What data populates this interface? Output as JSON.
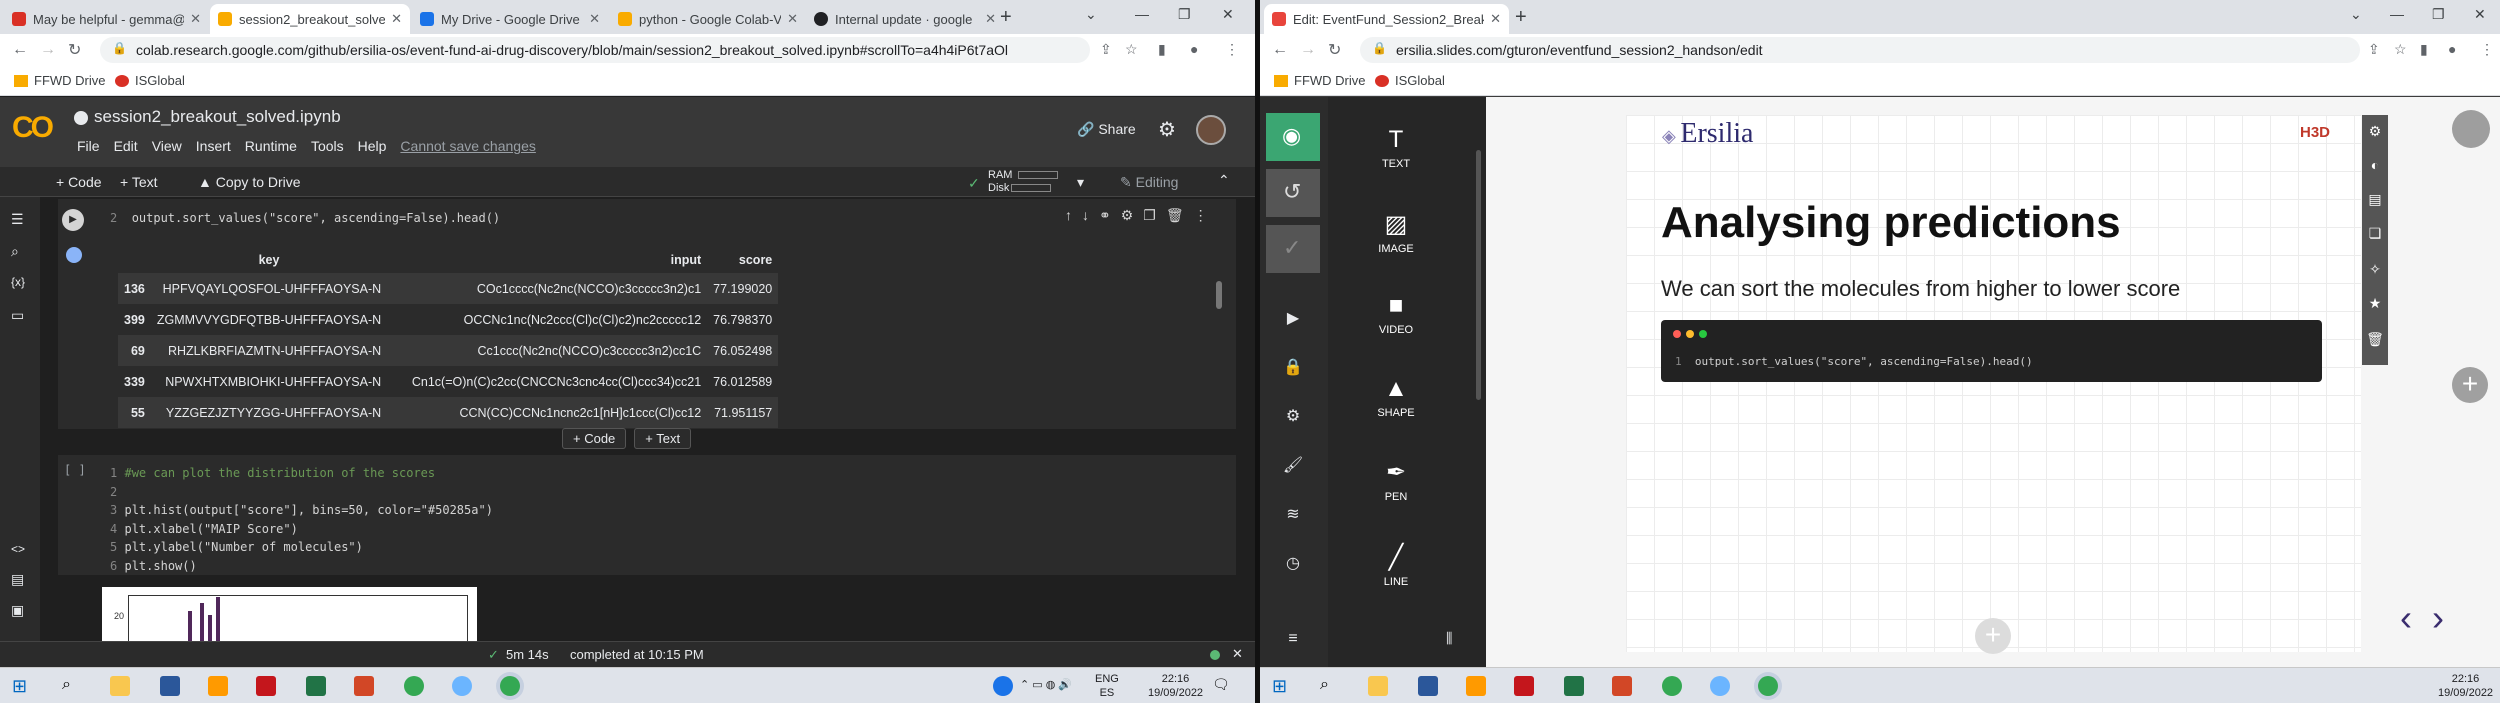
{
  "left_browser": {
    "tabs": [
      {
        "title": "May be helpful - gemma@",
        "color": "#d93025"
      },
      {
        "title": "session2_breakout_solved.",
        "color": "#f9ab00"
      },
      {
        "title": "My Drive - Google Drive",
        "color": "#1a73e8"
      },
      {
        "title": "python - Google Colab-V",
        "color": "#f9ab00"
      },
      {
        "title": "Internal update · google",
        "color": "#202124"
      }
    ],
    "url": "colab.research.google.com/github/ersilia-os/event-fund-ai-drug-discovery/blob/main/session2_breakout_solved.ipynb#scrollTo=a4h4iP6t7aOl",
    "bookmarks": [
      "FFWD Drive",
      "ISGlobal"
    ]
  },
  "colab": {
    "logo": "CO",
    "notebook_title": "session2_breakout_solved.ipynb",
    "menus": [
      "File",
      "Edit",
      "View",
      "Insert",
      "Runtime",
      "Tools",
      "Help"
    ],
    "cant_save": "Cannot save changes",
    "share": "Share",
    "toolbar": {
      "add_code": "+ Code",
      "add_text": "+ Text",
      "copy": "Copy to Drive",
      "ram": "RAM",
      "disk": "Disk",
      "editing": "Editing"
    },
    "cell1_code": {
      "line_no": "2",
      "code": "output.sort_values(\"score\", ascending=False).head()"
    },
    "table": {
      "headers": [
        "",
        "key",
        "input",
        "score"
      ],
      "rows": [
        [
          "136",
          "HPFVQAYLQOSFOL-UHFFFAOYSA-N",
          "COc1cccc(Nc2nc(NCCO)c3ccccc3n2)c1",
          "77.199020"
        ],
        [
          "399",
          "ZGMMVVYGDFQTBB-UHFFFAOYSA-N",
          "OCCNc1nc(Nc2ccc(Cl)c(Cl)c2)nc2ccccc12",
          "76.798370"
        ],
        [
          "69",
          "RHZLKBRFIAZMTN-UHFFFAOYSA-N",
          "Cc1ccc(Nc2nc(NCCO)c3ccccc3n2)cc1C",
          "76.052498"
        ],
        [
          "339",
          "NPWXHTXMBIOHKI-UHFFFAOYSA-N",
          "Cn1c(=O)n(C)c2cc(CNCCNc3cnc4cc(Cl)ccc34)cc21",
          "76.012589"
        ],
        [
          "55",
          "YZZGEZJZTYYZGG-UHFFFAOYSA-N",
          "CCN(CC)CCNc1ncnc2c1[nH]c1ccc(Cl)cc12",
          "71.951157"
        ]
      ]
    },
    "add_code": "+ Code",
    "add_text": "+ Text",
    "cell2": {
      "bracket": "[ ]",
      "lines": [
        {
          "n": "1",
          "text": "#we can plot the distribution of the scores"
        },
        {
          "n": "2",
          "text": ""
        },
        {
          "n": "3",
          "text": "plt.hist(output[\"score\"], bins=50, color=\"#50285a\")"
        },
        {
          "n": "4",
          "text": "plt.xlabel(\"MAIP Score\")"
        },
        {
          "n": "5",
          "text": "plt.ylabel(\"Number of molecules\")"
        },
        {
          "n": "6",
          "text": "plt.show()"
        }
      ]
    },
    "plot_ytick": "20",
    "status": {
      "duration": "5m 14s",
      "completed": "completed at 10:15 PM"
    }
  },
  "left_taskbar": {
    "lang": "ENG",
    "region": "ES",
    "time": "22:16",
    "date": "19/09/2022"
  },
  "right_browser": {
    "tab_title": "Edit: EventFund_Session2_Breako",
    "url": "ersilia.slides.com/gturon/eventfund_session2_handson/edit",
    "bookmarks": [
      "FFWD Drive",
      "ISGlobal"
    ]
  },
  "slides_editor": {
    "tools": [
      "TEXT",
      "IMAGE",
      "VIDEO",
      "SHAPE",
      "PEN",
      "LINE"
    ],
    "slide": {
      "brand": "Ersilia",
      "partner": "H3D",
      "title": "Analysing predictions",
      "subtitle": "We can sort the molecules from higher to lower score",
      "code_line_no": "1",
      "code": "output.sort_values(\"score\", ascending=False).head()"
    }
  },
  "right_taskbar": {
    "time": "22:16",
    "date": "19/09/2022"
  },
  "colors": {
    "accent_green": "#3ba672",
    "hist_color": "#50285a",
    "slides_nav": "#3a2d6e"
  }
}
